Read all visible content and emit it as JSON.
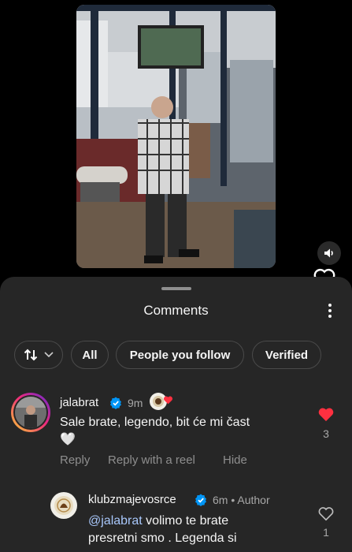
{
  "video": {
    "name": "reel-video",
    "sound_icon": "speaker-icon"
  },
  "sheet": {
    "title": "Comments",
    "more_icon": "more-vertical-icon",
    "filters": {
      "sort_icon": "sort-arrows-icon",
      "chevron_icon": "chevron-down-icon",
      "all": "All",
      "people_you_follow": "People you follow",
      "verified": "Verified"
    }
  },
  "comments": [
    {
      "username": "jalabrat",
      "verified": true,
      "time": "9m",
      "text": "Sale brate, legendo, bit će mi čast",
      "text_emoji": "🤍",
      "actions": {
        "reply": "Reply",
        "reply_with_reel": "Reply with a reel",
        "hide": "Hide"
      },
      "likes": "3",
      "liked": true
    }
  ],
  "replies": [
    {
      "username": "klubzmajevosrce",
      "verified": true,
      "time": "6m",
      "author_label": "Author",
      "mention": "@jalabrat",
      "text": "volimo te brate",
      "text_line2": "presretni  smo . Legenda si",
      "likes": "1",
      "liked": false
    }
  ],
  "colors": {
    "sheet_bg": "#262626",
    "like_red": "#ff3040",
    "verified_blue": "#0095f6",
    "mention": "#a8c7fa"
  }
}
